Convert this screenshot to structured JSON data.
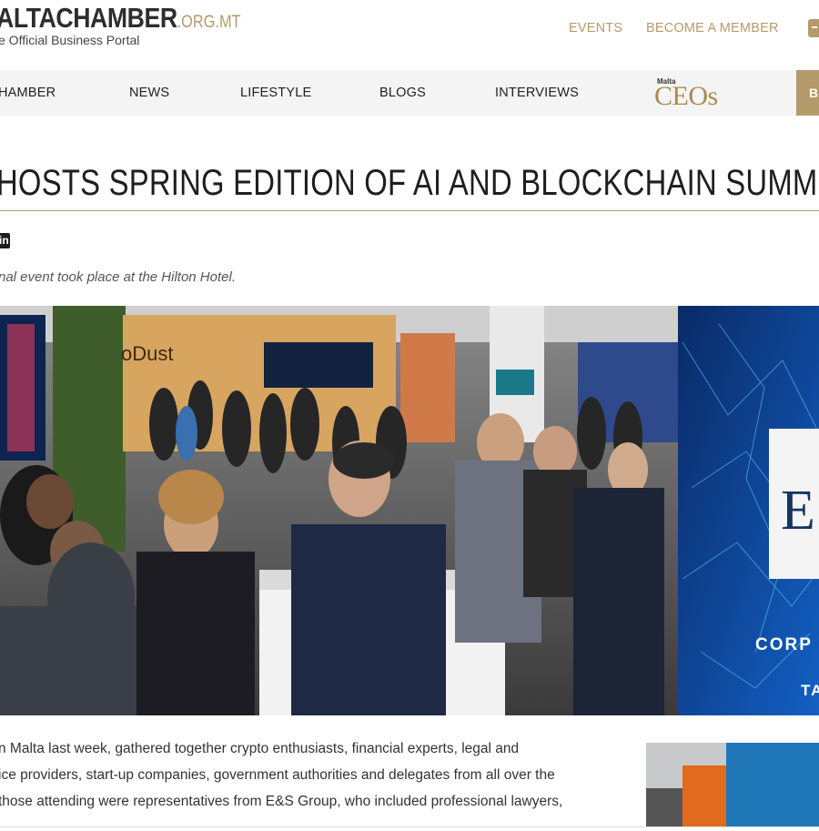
{
  "header": {
    "logo_name": "ALTACHAMBER",
    "logo_domain": ".ORG.MT",
    "logo_tagline": "e Official Business Portal",
    "links": [
      "EVENTS",
      "BECOME A MEMBER"
    ]
  },
  "nav": {
    "items": [
      "HAMBER",
      "NEWS",
      "LIFESTYLE",
      "BLOGS",
      "INTERVIEWS"
    ],
    "ceos_small": "Malta",
    "ceos_big": "CEOs",
    "right_label": "B"
  },
  "article": {
    "title": "HOSTS SPRING EDITION OF AI AND BLOCKCHAIN SUMMIT",
    "excerpt": "nal event took place at the Hilton Hotel.",
    "paragraph_lines": [
      "n Malta last week, gathered together crypto enthusiasts, financial experts, legal and",
      "ice providers, start-up companies, government authorities and delegates from all over the",
      "those attending were representatives from E&S Group, who included professional lawyers,"
    ]
  },
  "photo": {
    "booth_sign": "oDust",
    "screen_text_1": "CORP",
    "screen_text_2": "TA",
    "screen_logo": "E"
  },
  "colors": {
    "accent": "#b59a6a",
    "nav_bg": "#f4f4f4",
    "text": "#222222"
  },
  "icons": [
    "linkedin-icon",
    "plus-icon"
  ]
}
